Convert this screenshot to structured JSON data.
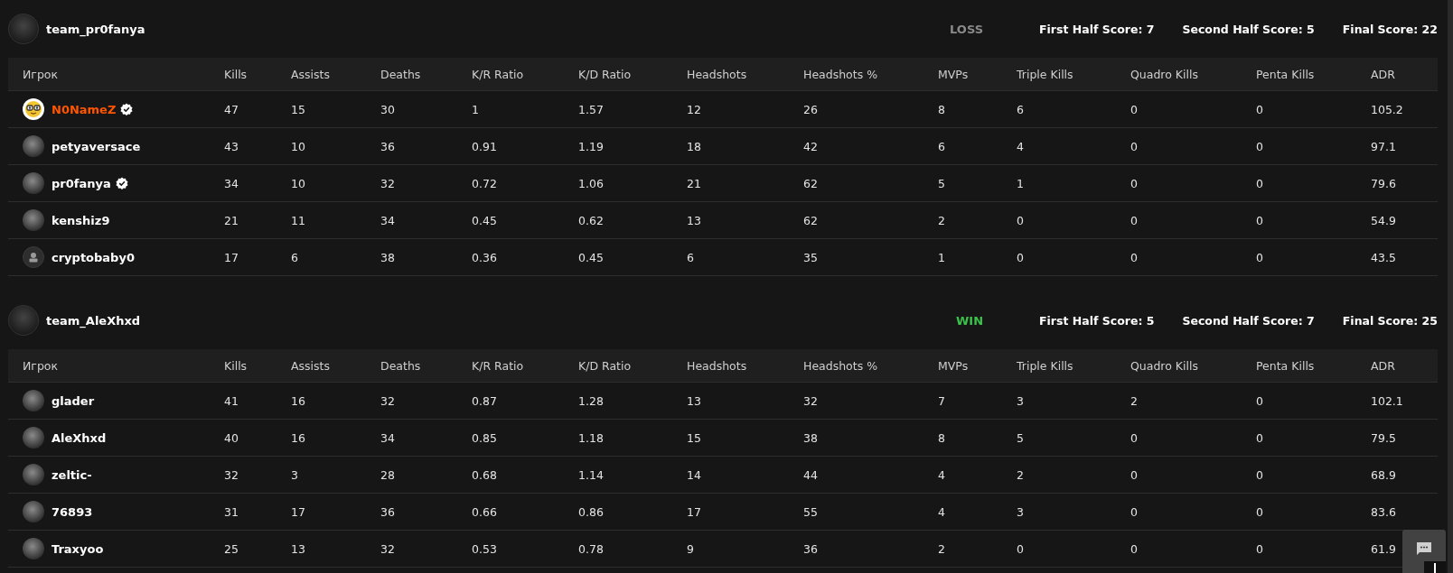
{
  "teams": [
    {
      "name": "team_pr0fanya",
      "result": {
        "kind": "loss",
        "text": "LOSS"
      },
      "scores": [
        "First Half Score: 7",
        "Second Half Score: 5",
        "Final Score: 22"
      ],
      "columns": [
        "Игрок",
        "Kills",
        "Assists",
        "Deaths",
        "K/R Ratio",
        "K/D Ratio",
        "Headshots",
        "Headshots %",
        "MVPs",
        "Triple Kills",
        "Quadro Kills",
        "Penta Kills",
        "ADR"
      ],
      "rows": [
        {
          "name": "N0NameZ",
          "avatar": {
            "kind": "emoji"
          },
          "verified": true,
          "highlighted": true,
          "stats": [
            "47",
            "15",
            "30",
            "1",
            "1.57",
            "12",
            "26",
            "8",
            "6",
            "0",
            "0",
            "105.2"
          ]
        },
        {
          "name": "petyaversace",
          "avatar": {
            "kind": "photo"
          },
          "verified": false,
          "highlighted": false,
          "stats": [
            "43",
            "10",
            "36",
            "0.91",
            "1.19",
            "18",
            "42",
            "6",
            "4",
            "0",
            "0",
            "97.1"
          ]
        },
        {
          "name": "pr0fanya",
          "avatar": {
            "kind": "photo"
          },
          "verified": true,
          "highlighted": false,
          "stats": [
            "34",
            "10",
            "32",
            "0.72",
            "1.06",
            "21",
            "62",
            "5",
            "1",
            "0",
            "0",
            "79.6"
          ]
        },
        {
          "name": "kenshiz9",
          "avatar": {
            "kind": "photo"
          },
          "verified": false,
          "highlighted": false,
          "stats": [
            "21",
            "11",
            "34",
            "0.45",
            "0.62",
            "13",
            "62",
            "2",
            "0",
            "0",
            "0",
            "54.9"
          ]
        },
        {
          "name": "cryptobaby0",
          "avatar": {
            "kind": "default"
          },
          "verified": false,
          "highlighted": false,
          "stats": [
            "17",
            "6",
            "38",
            "0.36",
            "0.45",
            "6",
            "35",
            "1",
            "0",
            "0",
            "0",
            "43.5"
          ]
        }
      ]
    },
    {
      "name": "team_AleXhxd",
      "result": {
        "kind": "win",
        "text": "WIN"
      },
      "scores": [
        "First Half Score: 5",
        "Second Half Score: 7",
        "Final Score: 25"
      ],
      "columns": [
        "Игрок",
        "Kills",
        "Assists",
        "Deaths",
        "K/R Ratio",
        "K/D Ratio",
        "Headshots",
        "Headshots %",
        "MVPs",
        "Triple Kills",
        "Quadro Kills",
        "Penta Kills",
        "ADR"
      ],
      "rows": [
        {
          "name": "glader",
          "avatar": {
            "kind": "photo"
          },
          "verified": false,
          "highlighted": false,
          "stats": [
            "41",
            "16",
            "32",
            "0.87",
            "1.28",
            "13",
            "32",
            "7",
            "3",
            "2",
            "0",
            "102.1"
          ]
        },
        {
          "name": "AleXhxd",
          "avatar": {
            "kind": "photo"
          },
          "verified": false,
          "highlighted": false,
          "stats": [
            "40",
            "16",
            "34",
            "0.85",
            "1.18",
            "15",
            "38",
            "8",
            "5",
            "0",
            "0",
            "79.5"
          ]
        },
        {
          "name": "zeltic-",
          "avatar": {
            "kind": "photo"
          },
          "verified": false,
          "highlighted": false,
          "stats": [
            "32",
            "3",
            "28",
            "0.68",
            "1.14",
            "14",
            "44",
            "4",
            "2",
            "0",
            "0",
            "68.9"
          ]
        },
        {
          "name": "76893",
          "avatar": {
            "kind": "photo"
          },
          "verified": false,
          "highlighted": false,
          "stats": [
            "31",
            "17",
            "36",
            "0.66",
            "0.86",
            "17",
            "55",
            "4",
            "3",
            "0",
            "0",
            "83.6"
          ]
        },
        {
          "name": "Traxyoo",
          "avatar": {
            "kind": "photo"
          },
          "verified": false,
          "highlighted": false,
          "stats": [
            "25",
            "13",
            "32",
            "0.53",
            "0.78",
            "9",
            "36",
            "2",
            "0",
            "0",
            "0",
            "61.9"
          ]
        }
      ]
    }
  ]
}
